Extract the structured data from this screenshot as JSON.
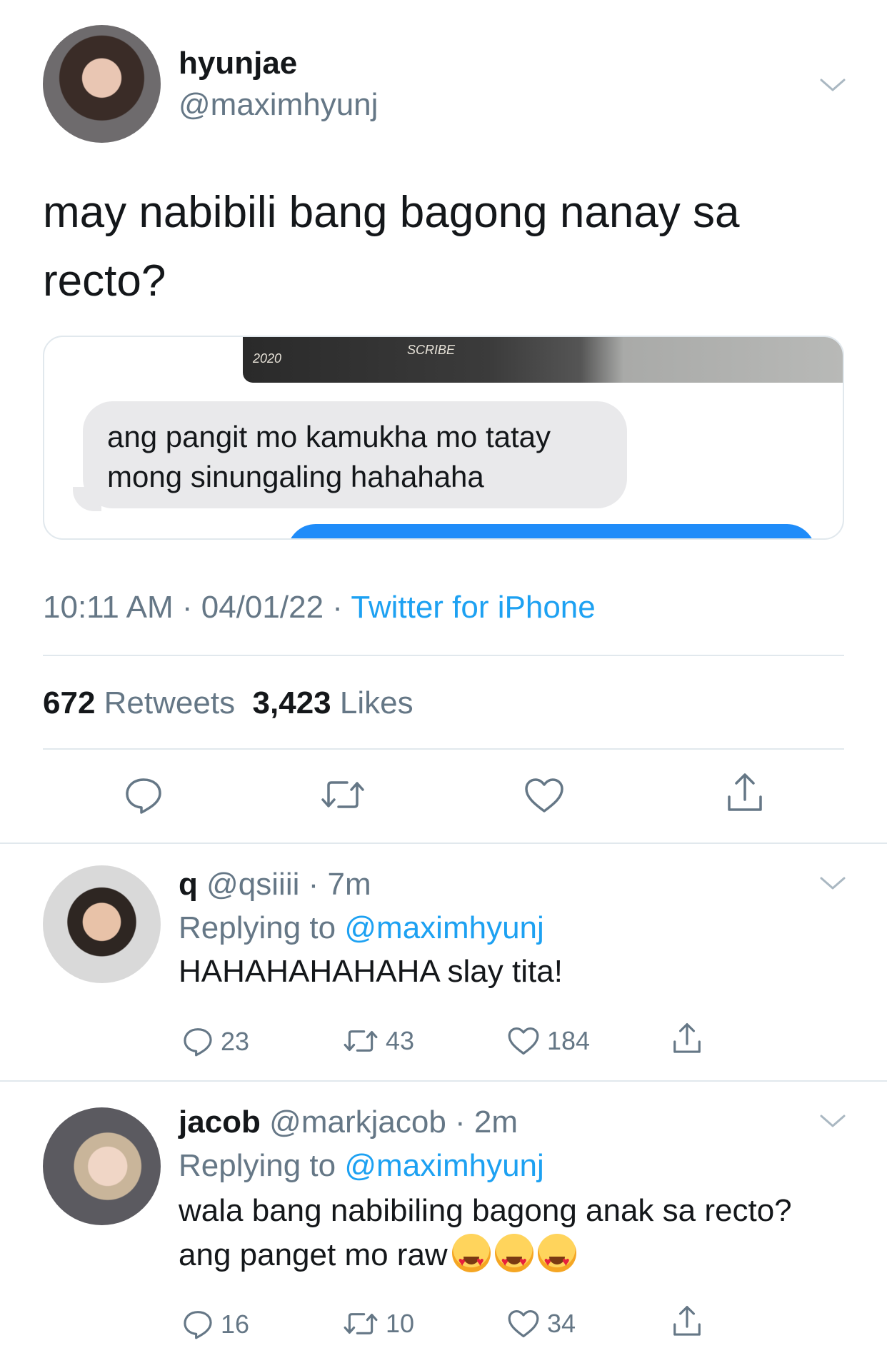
{
  "tweet": {
    "display_name": "hyunjae",
    "handle": "@maximhyunj",
    "text": "may nabibili bang bagong nanay sa recto?",
    "media": {
      "incoming_message": "ang pangit mo kamukha mo tatay mong sinungaling hahahaha",
      "photo_text_1": "2020",
      "photo_text_2": "SCRIBE"
    },
    "time": "10:11 AM",
    "date": "04/01/22",
    "source": "Twitter for iPhone",
    "retweets_count": "672",
    "retweets_label": "Retweets",
    "likes_count": "3,423",
    "likes_label": "Likes",
    "actions": [
      "reply-icon",
      "retweet-icon",
      "like-icon",
      "share-icon"
    ]
  },
  "replies": [
    {
      "display_name": "q",
      "handle": "@qsiiii",
      "time": "7m",
      "replying_label": "Replying to",
      "replying_to": "@maximhyunj",
      "text": "HAHAHAHAHAHA slay tita!",
      "reply_count": "23",
      "retweet_count": "43",
      "like_count": "184"
    },
    {
      "display_name": "jacob",
      "handle": "@markjacob",
      "time": "2m",
      "replying_label": "Replying to",
      "replying_to": "@maximhyunj",
      "text": "wala bang nabibiling bagong anak sa recto? ang panget mo raw",
      "emoji_icons": [
        "heart-eyes-emoji",
        "heart-eyes-emoji",
        "heart-eyes-emoji"
      ],
      "reply_count": "16",
      "retweet_count": "10",
      "like_count": "34"
    }
  ],
  "colors": {
    "text": "#14171a",
    "muted": "#657786",
    "link": "#1da1f2",
    "divider": "#e1e8ed",
    "imessage_blue": "#1f8cf9",
    "imessage_gray": "#e9e9eb"
  }
}
